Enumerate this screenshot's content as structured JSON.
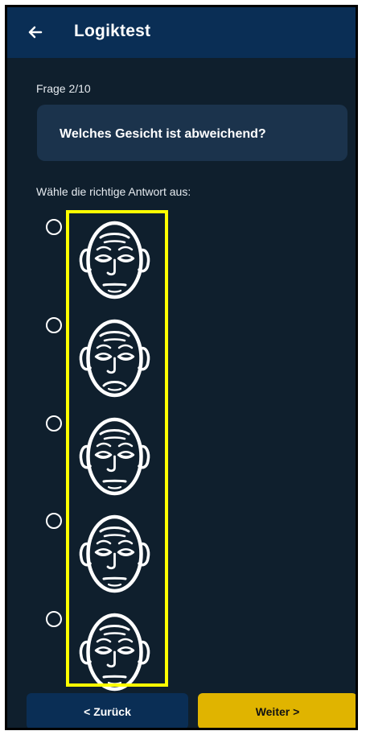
{
  "header": {
    "title": "Logiktest",
    "back_icon": "arrow-left-icon",
    "background_color": "#0a2e55"
  },
  "quiz": {
    "progress": "Frage 2/10",
    "question": "Welches Gesicht ist abweichend?",
    "instruction": "Wähle die richtige Antwort aus:",
    "options": [
      {
        "icon": "face-option-1-icon",
        "mouth": "straight",
        "selected": false
      },
      {
        "icon": "face-option-2-icon",
        "mouth": "frown",
        "selected": false
      },
      {
        "icon": "face-option-3-icon",
        "mouth": "straight",
        "selected": false
      },
      {
        "icon": "face-option-4-icon",
        "mouth": "straight",
        "selected": false
      },
      {
        "icon": "face-option-5-icon",
        "mouth": "straight",
        "selected": false
      }
    ]
  },
  "footer": {
    "back_label": "< Zurück",
    "next_label": "Weiter >",
    "next_color": "#e0b400",
    "back_color": "#0a2e55"
  },
  "highlight": {
    "color": "#ffff00"
  }
}
